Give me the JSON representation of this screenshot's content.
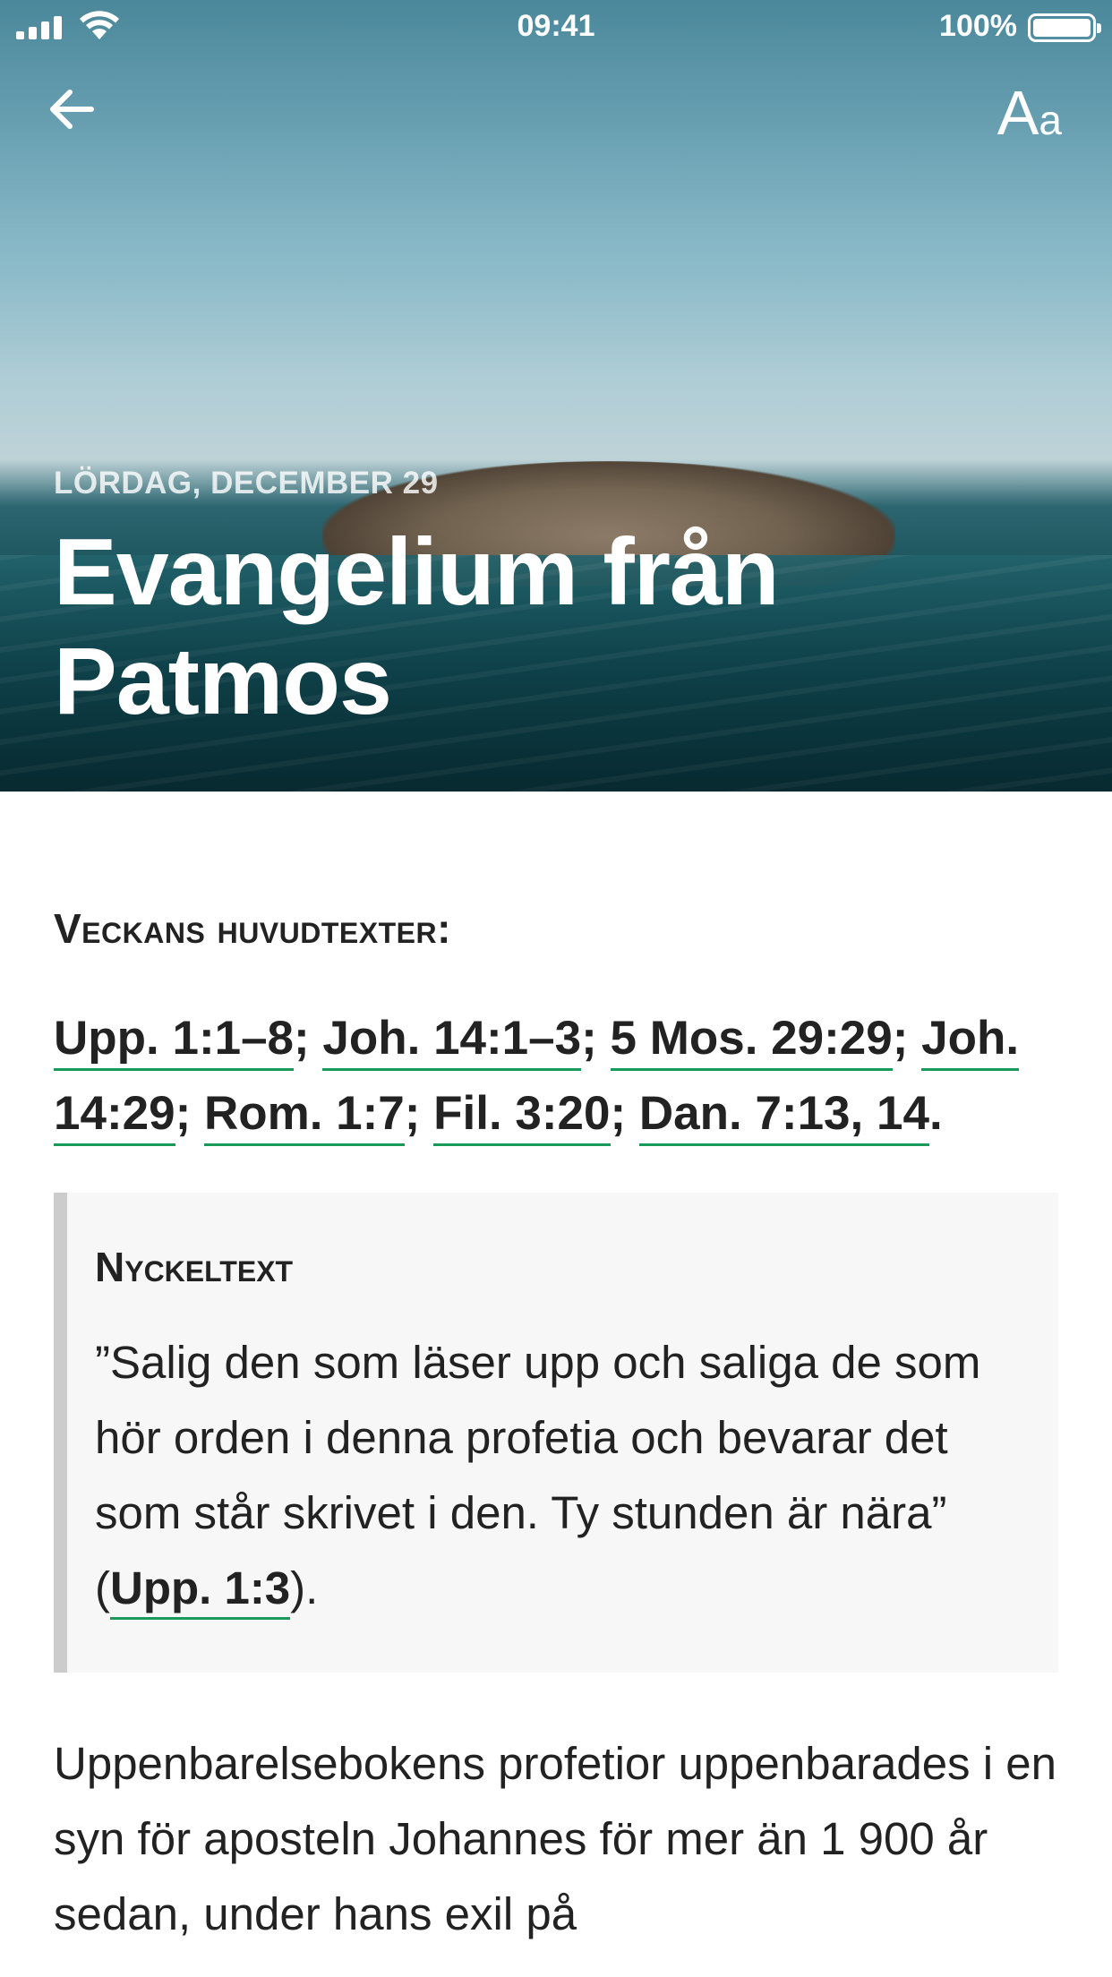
{
  "status_bar": {
    "time": "09:41",
    "battery_percent": "100%",
    "battery_level": 1.0
  },
  "header": {
    "font_size_label_large": "A",
    "font_size_label_small": "a"
  },
  "hero": {
    "date": "LÖRDAG, DECEMBER 29",
    "title": "Evangelium från Patmos"
  },
  "sections": {
    "main_texts_heading": "Veckans huvudtexter:",
    "references": [
      {
        "text": "Upp. 1:1–8",
        "sep": "; "
      },
      {
        "text": "Joh. 14:1–3",
        "sep": "; "
      },
      {
        "text": "5 Mos. 29:29",
        "sep": "; "
      },
      {
        "text": "Joh. 14:29",
        "sep": "; "
      },
      {
        "text": "Rom. 1:7",
        "sep": "; "
      },
      {
        "text": "Fil. 3:20",
        "sep": "; "
      },
      {
        "text": "Dan. 7:13, 14",
        "sep": "."
      }
    ],
    "key_text": {
      "label": "Nyckeltext",
      "quote": "”Salig den som läser upp och saliga de som hör orden i denna profetia och bevarar det som står skrivet i den. Ty stunden är nära” (",
      "reference": "Upp. 1:3",
      "closing": ")."
    },
    "body": "Uppenbarelsebokens profetior uppenbarades i en syn för aposteln Johannes för mer än 1 900 år sedan, under hans exil på"
  },
  "colors": {
    "link_underline": "#1a9a5a",
    "blockquote_bg": "#f7f7f7",
    "blockquote_border": "#cccccc",
    "text": "#222222"
  },
  "icons": {
    "back": "arrow-left-icon",
    "font_size": "font-size-icon",
    "signal": "cellular-signal-icon",
    "wifi": "wifi-icon",
    "battery": "battery-icon"
  }
}
